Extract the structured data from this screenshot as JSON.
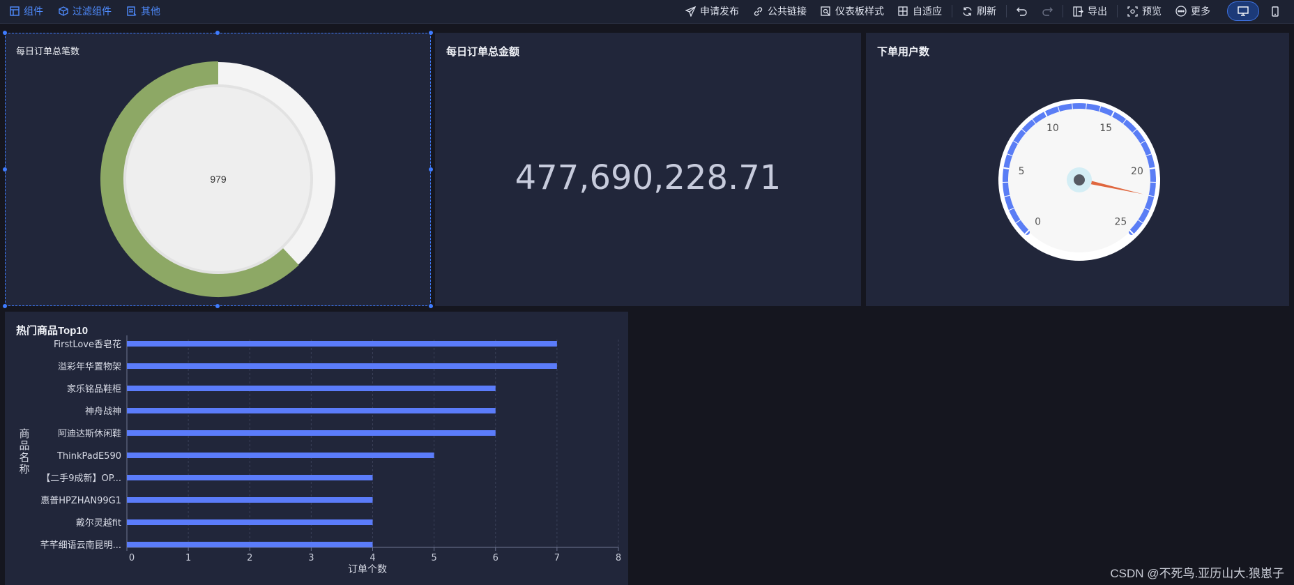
{
  "toolbar": {
    "left": [
      {
        "label": "组件",
        "icon": "component-icon"
      },
      {
        "label": "过滤组件",
        "icon": "filter-cube-icon"
      },
      {
        "label": "其他",
        "icon": "other-icon"
      }
    ],
    "right": [
      {
        "label": "申请发布",
        "icon": "send-icon"
      },
      {
        "label": "公共链接",
        "icon": "link-icon"
      },
      {
        "label": "仪表板样式",
        "icon": "style-icon"
      },
      {
        "label": "自适应",
        "icon": "grid-icon"
      },
      {
        "label": "刷新",
        "icon": "refresh-icon"
      },
      {
        "label": "导出",
        "icon": "export-icon"
      },
      {
        "label": "预览",
        "icon": "preview-icon"
      },
      {
        "label": "更多",
        "icon": "more-icon"
      }
    ]
  },
  "panels": {
    "orders_count": {
      "title": "每日订单总笔数",
      "value": "979",
      "colors": {
        "ring": "#8da865",
        "track": "#f4f4f4",
        "inner": "#eeeeee"
      },
      "fill_fraction": 0.62
    },
    "orders_amount": {
      "title": "每日订单总金额",
      "value": "477,690,228.71"
    },
    "users": {
      "title": "下单用户数",
      "gauge": {
        "min": 0,
        "max": 25,
        "value": 22,
        "ticks": [
          "0",
          "5",
          "10",
          "15",
          "20",
          "25"
        ],
        "colors": {
          "arc": "#5a7df5",
          "needle": "#e0673f",
          "hub": "#555a63"
        }
      }
    },
    "top10": {
      "title": "热门商品Top10"
    }
  },
  "chart_data": {
    "type": "bar",
    "orientation": "horizontal",
    "title": "热门商品Top10",
    "xlabel": "订单个数",
    "ylabel": "商品名称",
    "categories": [
      "FirstLove香皂花",
      "溢彩年华置物架",
      "家乐铭品鞋柜",
      "神舟战神",
      "阿迪达斯休闲鞋",
      "ThinkPadE590",
      "【二手9成新】OP...",
      "惠普HPZHAN99G1",
      "戴尔灵越fit",
      "芊芊细语云南昆明..."
    ],
    "values": [
      7,
      7,
      6,
      6,
      6,
      5,
      4,
      4,
      4,
      4
    ],
    "xlim": [
      0,
      8
    ],
    "xticks": [
      "0",
      "1",
      "2",
      "3",
      "4",
      "5",
      "6",
      "7",
      "8"
    ],
    "grid": true,
    "bar_color": "#5b7cfa"
  },
  "watermark": "CSDN @不死鸟.亚历山大.狼崽子"
}
